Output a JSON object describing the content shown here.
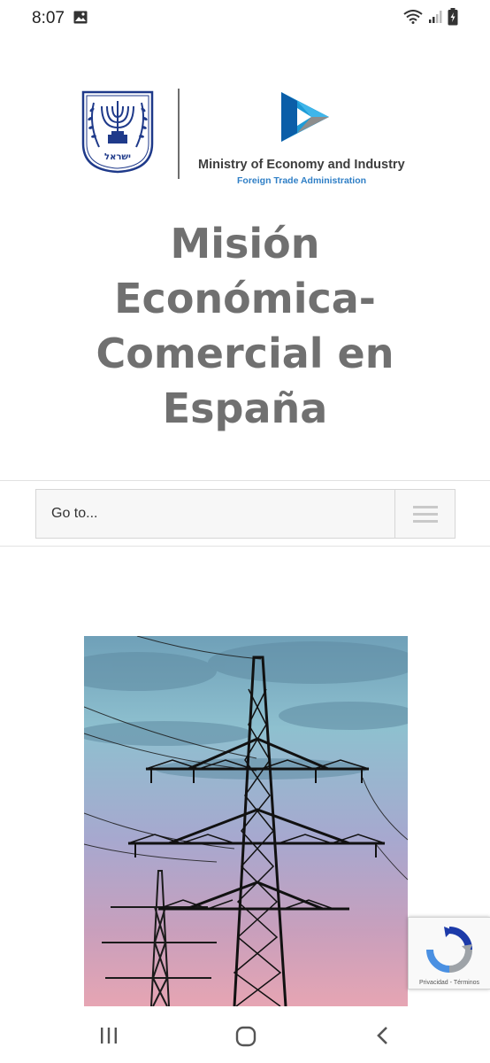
{
  "status_bar": {
    "time": "8:07",
    "icons": [
      "image-notification-icon",
      "wifi-icon",
      "signal-icon",
      "battery-icon"
    ]
  },
  "header": {
    "emblem_icon": "israel-emblem-icon",
    "emblem_lettering": "ישראל",
    "ministry_logo_icon": "play-logo-icon",
    "ministry_name": "Ministry of Economy and Industry",
    "ministry_subtitle": "Foreign Trade Administration",
    "colors": {
      "ministry_name": "#3d3d3d",
      "subtitle": "#2f7fc6",
      "emblem": "#1f3a8a"
    }
  },
  "site": {
    "title_lines": [
      "Misión",
      "Económica-",
      "Comercial en",
      "España"
    ],
    "title_color": "#707070"
  },
  "navigation": {
    "select_label": "Go to...",
    "menu_icon": "hamburger-icon"
  },
  "main": {
    "hero_image": "power-transmission-towers-image"
  },
  "recaptcha": {
    "privacy_label": "Privacidad",
    "separator": "-",
    "terms_label": "Términos",
    "icon": "recaptcha-icon"
  },
  "system_nav": {
    "buttons": [
      "recent-apps-icon",
      "home-icon",
      "back-icon"
    ]
  }
}
